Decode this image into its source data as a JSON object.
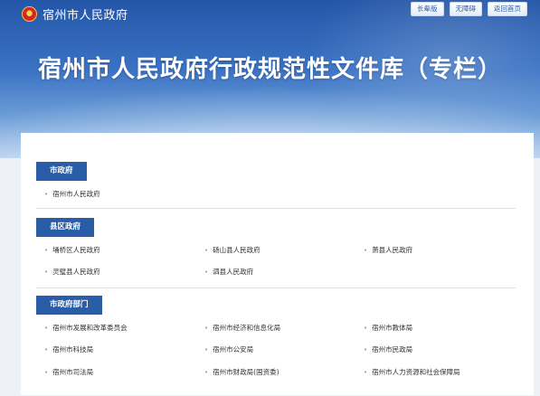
{
  "header": {
    "site_name": "宿州市人民政府",
    "buttons": [
      "长辈版",
      "无障碍",
      "返回首页"
    ],
    "title": "宿州市人民政府行政规范性文件库（专栏）"
  },
  "sections": [
    {
      "title": "市政府",
      "items": [
        "宿州市人民政府"
      ]
    },
    {
      "title": "县区政府",
      "items": [
        "埇桥区人民政府",
        "砀山县人民政府",
        "萧县人民政府",
        "灵璧县人民政府",
        "泗县人民政府"
      ]
    },
    {
      "title": "市政府部门",
      "items": [
        "宿州市发展和改革委员会",
        "宿州市经济和信息化局",
        "宿州市教体局",
        "宿州市科技局",
        "宿州市公安局",
        "宿州市民政局",
        "宿州市司法局",
        "宿州市财政局(国资委)",
        "宿州市人力资源和社会保障局"
      ]
    }
  ]
}
